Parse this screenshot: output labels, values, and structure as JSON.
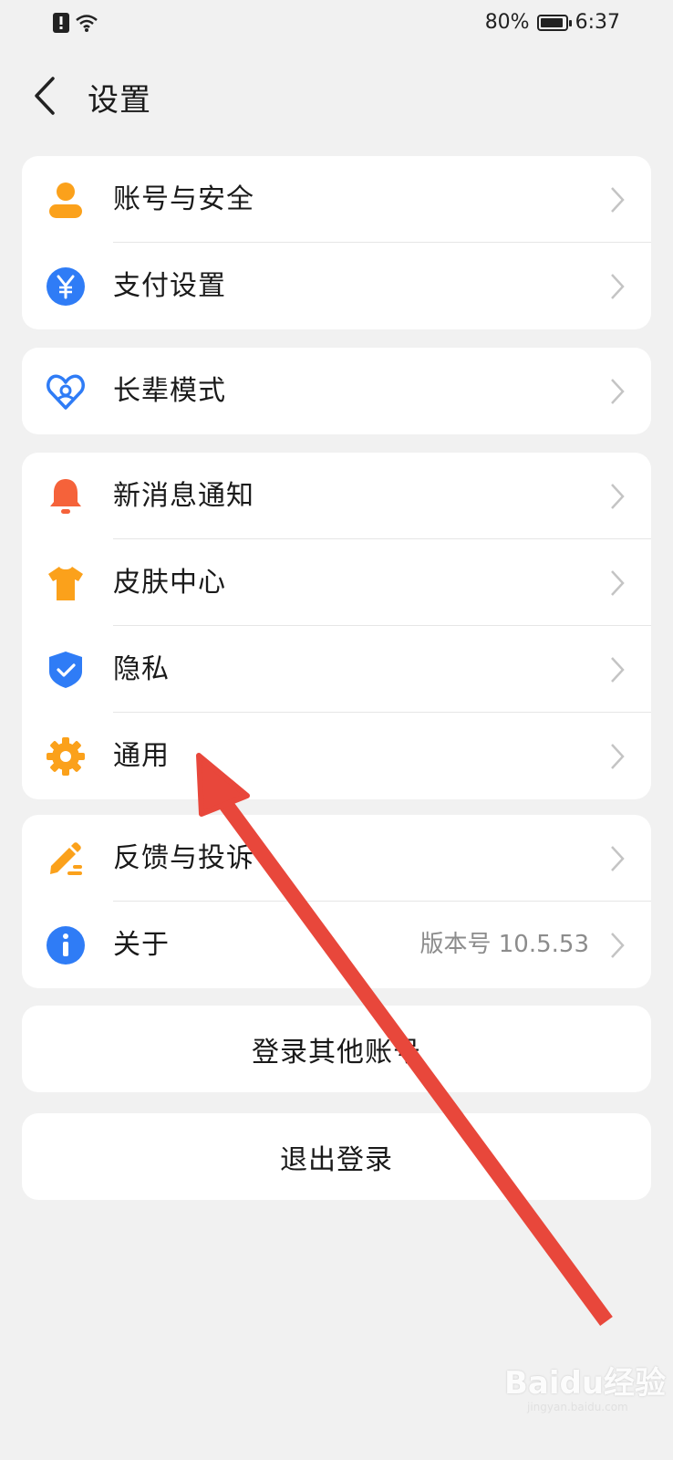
{
  "status_bar": {
    "battery": "80%",
    "time": "6:37",
    "battery_level": 0.8
  },
  "header": {
    "title": "设置"
  },
  "group1": [
    {
      "label": "账号与安全",
      "icon": "person-icon"
    },
    {
      "label": "支付设置",
      "icon": "yen-icon"
    }
  ],
  "group2": [
    {
      "label": "长辈模式",
      "icon": "heart-icon"
    }
  ],
  "group3": [
    {
      "label": "新消息通知",
      "icon": "bell-icon"
    },
    {
      "label": "皮肤中心",
      "icon": "shirt-icon"
    },
    {
      "label": "隐私",
      "icon": "shield-icon"
    },
    {
      "label": "通用",
      "icon": "gear-icon"
    }
  ],
  "group4": [
    {
      "label": "反馈与投诉",
      "icon": "pencil-icon"
    },
    {
      "label": "关于",
      "icon": "info-icon",
      "value": "版本号 10.5.53"
    }
  ],
  "buttons": {
    "switch_account": "登录其他账号",
    "logout": "退出登录"
  },
  "watermark": {
    "brand": "Baidu经验",
    "url": "jingyan.baidu.com"
  },
  "colors": {
    "orange": "#fba11b",
    "blue": "#2f7cf6",
    "red_orange": "#f5623a",
    "arrow": "#e8473b"
  }
}
